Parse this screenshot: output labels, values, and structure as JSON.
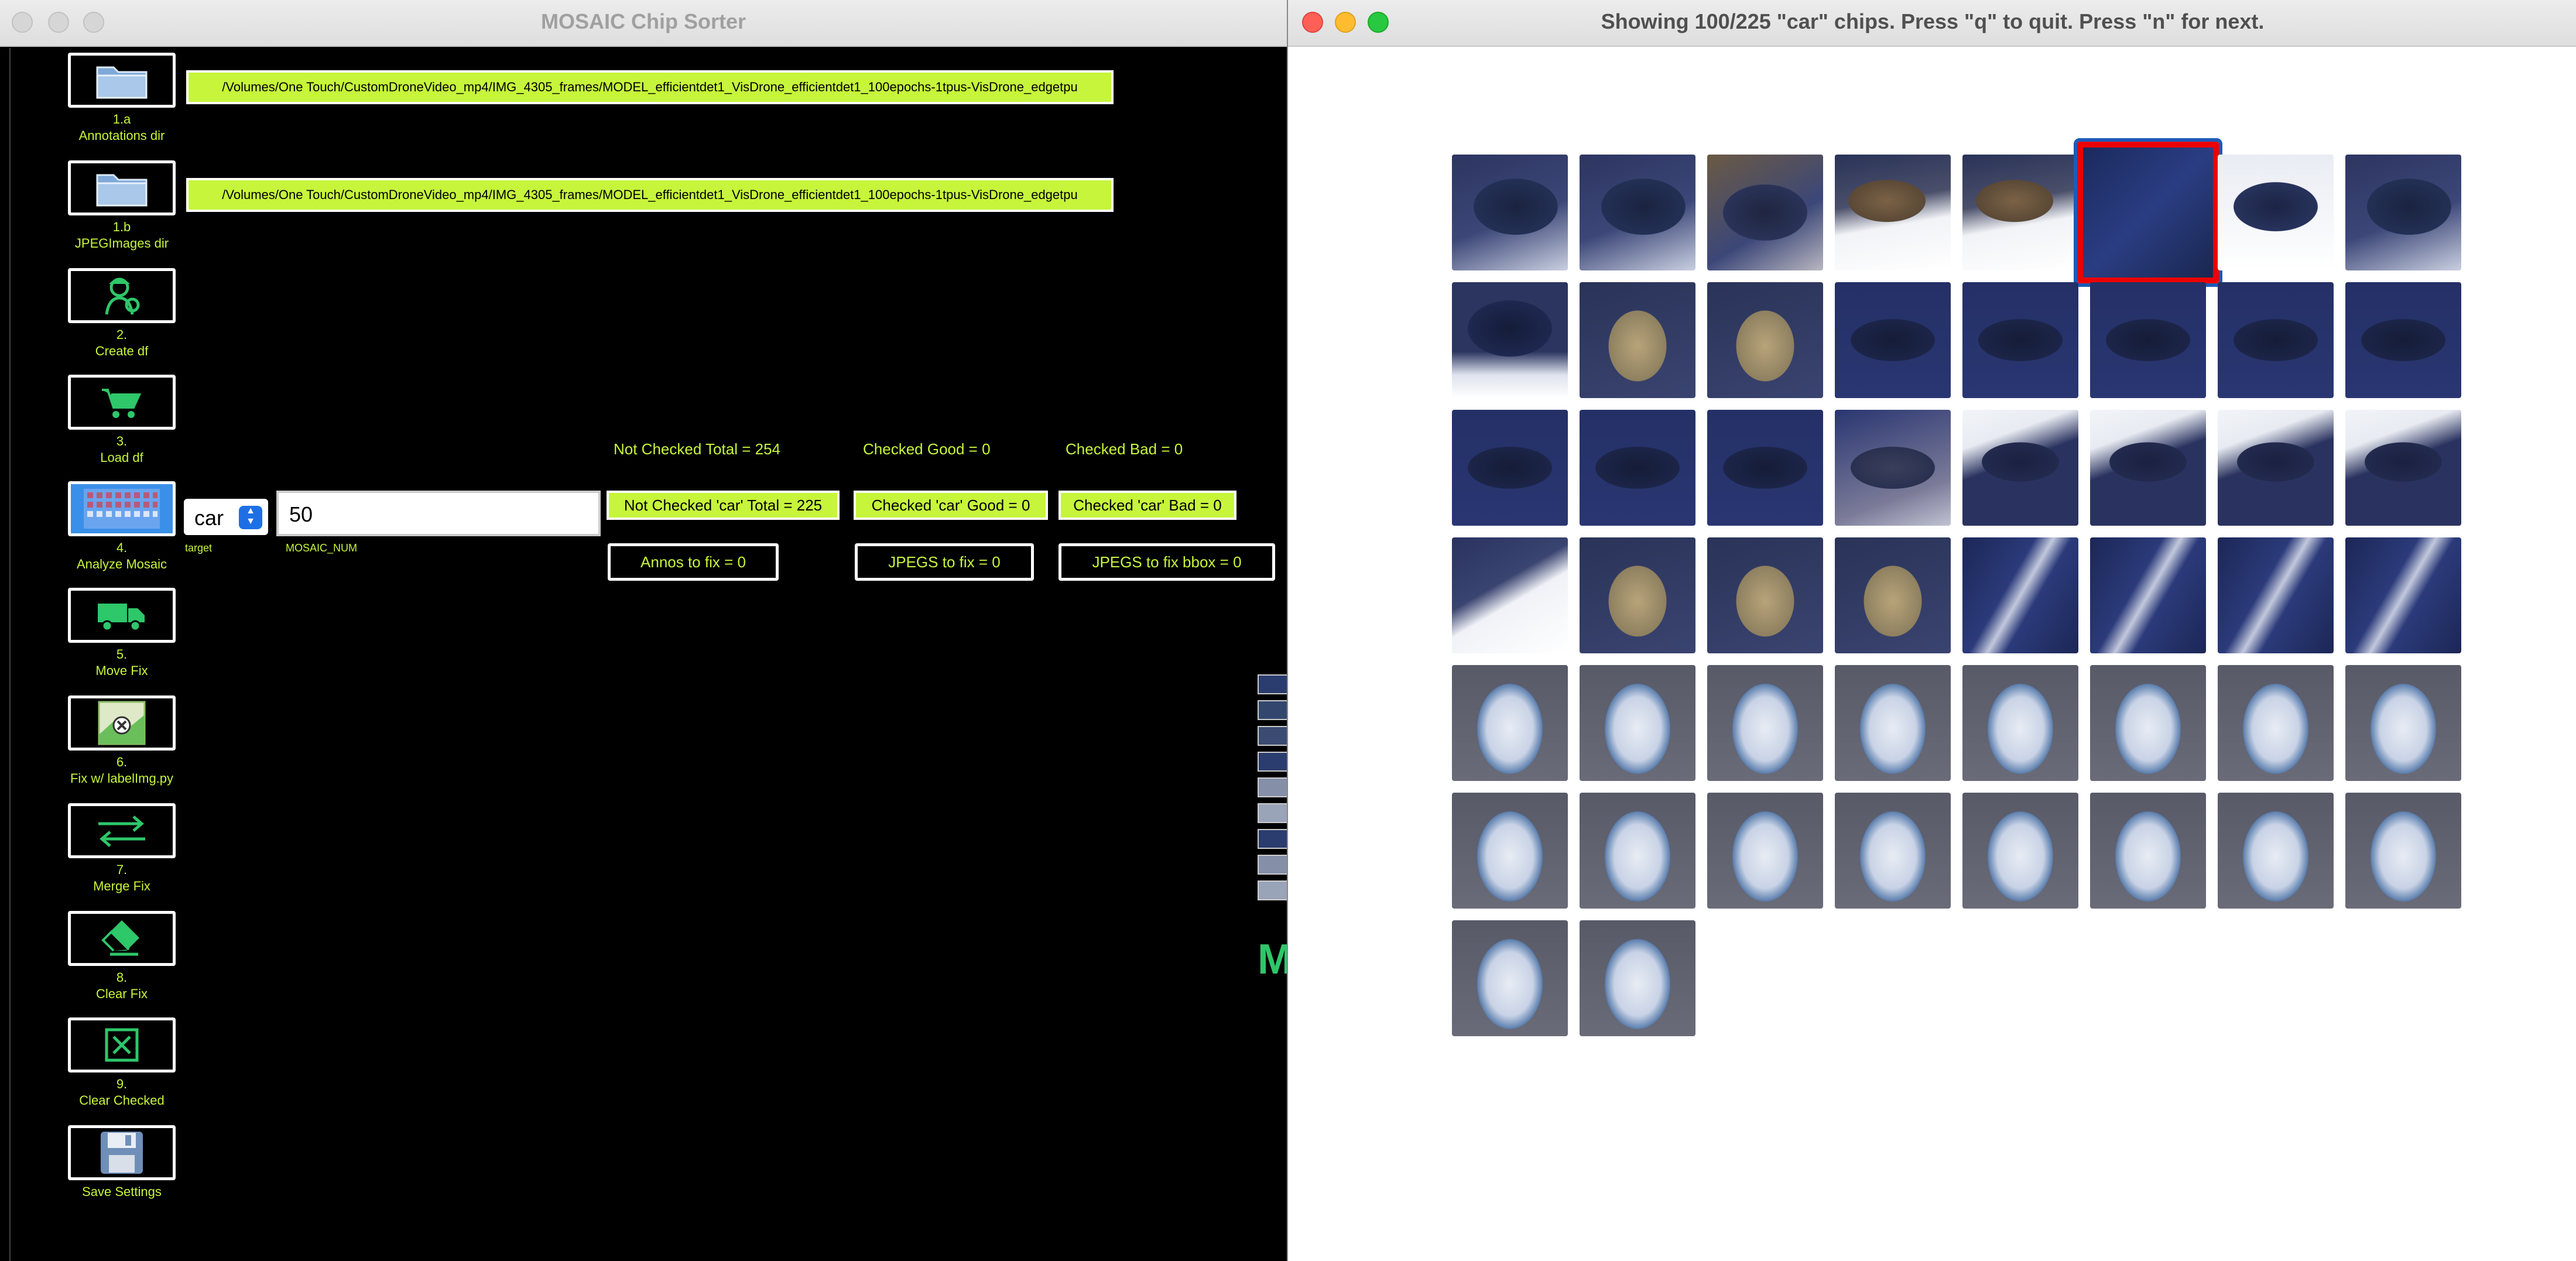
{
  "left_window": {
    "title": "MOSAIC Chip Sorter",
    "annotations_path": "/Volumes/One Touch/CustomDroneVideo_mp4/IMG_4305_frames/MODEL_efficientdet1_VisDrone_efficientdet1_100epochs-1tpus-VisDrone_edgetpu",
    "jpeg_path": "/Volumes/One Touch/CustomDroneVideo_mp4/IMG_4305_frames/MODEL_efficientdet1_VisDrone_efficientdet1_100epochs-1tpus-VisDrone_edgetpu",
    "buttons": [
      {
        "num": "1.a",
        "label": "Annotations dir",
        "icon": "folder-icon"
      },
      {
        "num": "1.b",
        "label": "JPEGImages dir",
        "icon": "folder-icon"
      },
      {
        "num": "2.",
        "label": "Create df",
        "icon": "worker-icon"
      },
      {
        "num": "3.",
        "label": "Load df",
        "icon": "cart-icon"
      },
      {
        "num": "4.",
        "label": "Analyze Mosaic",
        "icon": "mosaic-icon"
      },
      {
        "num": "5.",
        "label": "Move Fix",
        "icon": "truck-icon"
      },
      {
        "num": "6.",
        "label": "Fix w/ labelImg.py",
        "icon": "image-fix-icon"
      },
      {
        "num": "7.",
        "label": "Merge Fix",
        "icon": "swap-arrows-icon"
      },
      {
        "num": "8.",
        "label": "Clear Fix",
        "icon": "eraser-icon"
      },
      {
        "num": "9.",
        "label": "Clear Checked",
        "icon": "x-box-icon"
      },
      {
        "num": "",
        "label": "Save Settings",
        "icon": "floppy-icon"
      }
    ],
    "target": {
      "value": "car",
      "label": "target"
    },
    "mosaic_num": {
      "value": "50",
      "label": "MOSAIC_NUM"
    },
    "stats": {
      "not_checked_total": "Not Checked Total = 254",
      "checked_good": "Checked Good = 0",
      "checked_bad": "Checked Bad = 0",
      "not_checked_car": "Not Checked 'car' Total = 225",
      "checked_car_good": "Checked 'car' Good = 0",
      "checked_car_bad": "Checked 'car' Bad = 0",
      "annos_fix": "Annos to fix = 0",
      "jpegs_fix": "JPEGS to fix = 0",
      "jpegs_fix_bbox": "JPEGS to fix bbox = 0"
    },
    "edge_letter": "M",
    "colors": {
      "accent": "#c6f53b",
      "background": "#000000",
      "selected": "#3a8fe8"
    }
  },
  "right_window": {
    "title": "Showing 100/225 \"car\" chips.  Press \"q\" to quit.  Press \"n\" for next.",
    "chip_count": 50,
    "columns": 8,
    "highlighted_index": 5,
    "highlight_color": "#ee0000",
    "chips": [
      {
        "style": "dark-suv"
      },
      {
        "style": "dark-suv"
      },
      {
        "style": "dark-suv-brown"
      },
      {
        "style": "snow-brown"
      },
      {
        "style": "snow-brown"
      },
      {
        "style": "dark-blur"
      },
      {
        "style": "snow-dark"
      },
      {
        "style": "dark-suv"
      },
      {
        "style": "dark-snow"
      },
      {
        "style": "gold"
      },
      {
        "style": "gold"
      },
      {
        "style": "navy-car"
      },
      {
        "style": "navy-car"
      },
      {
        "style": "navy-car"
      },
      {
        "style": "navy-car"
      },
      {
        "style": "navy-car"
      },
      {
        "style": "navy-car"
      },
      {
        "style": "navy-car"
      },
      {
        "style": "navy-car"
      },
      {
        "style": "navy-car-light"
      },
      {
        "style": "road-car"
      },
      {
        "style": "road-car"
      },
      {
        "style": "road-car"
      },
      {
        "style": "road-car"
      },
      {
        "style": "snow-road"
      },
      {
        "style": "gold"
      },
      {
        "style": "gold"
      },
      {
        "style": "gold"
      },
      {
        "style": "navy-glass"
      },
      {
        "style": "navy-glass"
      },
      {
        "style": "navy-glass"
      },
      {
        "style": "navy-glass"
      },
      {
        "style": "white-car"
      },
      {
        "style": "white-car"
      },
      {
        "style": "white-car"
      },
      {
        "style": "white-car"
      },
      {
        "style": "white-car"
      },
      {
        "style": "white-car"
      },
      {
        "style": "white-car"
      },
      {
        "style": "white-car"
      },
      {
        "style": "white-car"
      },
      {
        "style": "white-car"
      },
      {
        "style": "white-car"
      },
      {
        "style": "white-car"
      },
      {
        "style": "white-car"
      },
      {
        "style": "white-car"
      },
      {
        "style": "white-car"
      },
      {
        "style": "white-car"
      },
      {
        "style": "white-car"
      },
      {
        "style": "white-car"
      }
    ]
  }
}
